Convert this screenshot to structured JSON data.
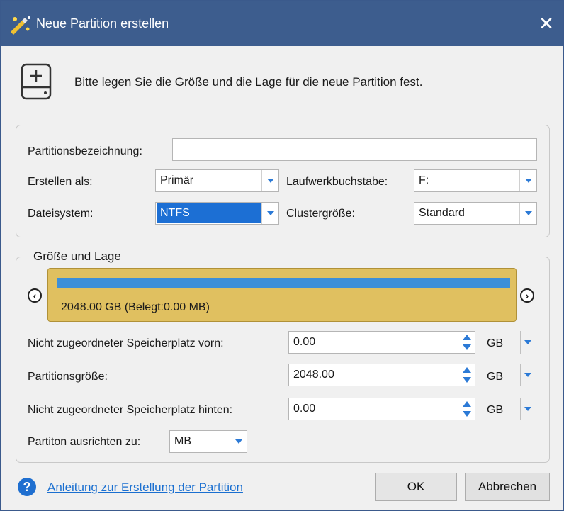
{
  "window": {
    "title": "Neue Partition erstellen",
    "close_symbol": "✕"
  },
  "header": {
    "text": "Bitte legen Sie die Größe und die Lage für die neue Partition fest."
  },
  "form": {
    "label_name": "Partitionsbezeichnung:",
    "name_value": "",
    "label_create_as": "Erstellen als:",
    "create_as_value": "Primär",
    "label_drive_letter": "Laufwerkbuchstabe:",
    "drive_letter_value": "F:",
    "label_filesystem": "Dateisystem:",
    "filesystem_value": "NTFS",
    "label_cluster": "Clustergröße:",
    "cluster_value": "Standard"
  },
  "size_group": {
    "legend": "Größe und Lage",
    "disk_text": "2048.00 GB (Belegt:0.00 MB)",
    "disk_fill_fraction": 1.0,
    "nav_left": "‹",
    "nav_right": "›",
    "label_before": "Nicht zugeordneter Speicherplatz vorn:",
    "before_value": "0.00",
    "before_unit": "GB",
    "label_size": "Partitionsgröße:",
    "size_value": "2048.00",
    "size_unit": "GB",
    "label_after": "Nicht zugeordneter Speicherplatz hinten:",
    "after_value": "0.00",
    "after_unit": "GB",
    "label_align": "Partiton ausrichten zu:",
    "align_value": "MB"
  },
  "footer": {
    "help_symbol": "?",
    "help_link": "Anleitung zur Erstellung der Partition",
    "ok_label": "OK",
    "cancel_label": "Abbrechen"
  },
  "colors": {
    "titlebar": "#3d5d8e",
    "disk_bar": "#e0c060",
    "disk_fill": "#3d8fd8",
    "accent": "#1c6fd4"
  }
}
